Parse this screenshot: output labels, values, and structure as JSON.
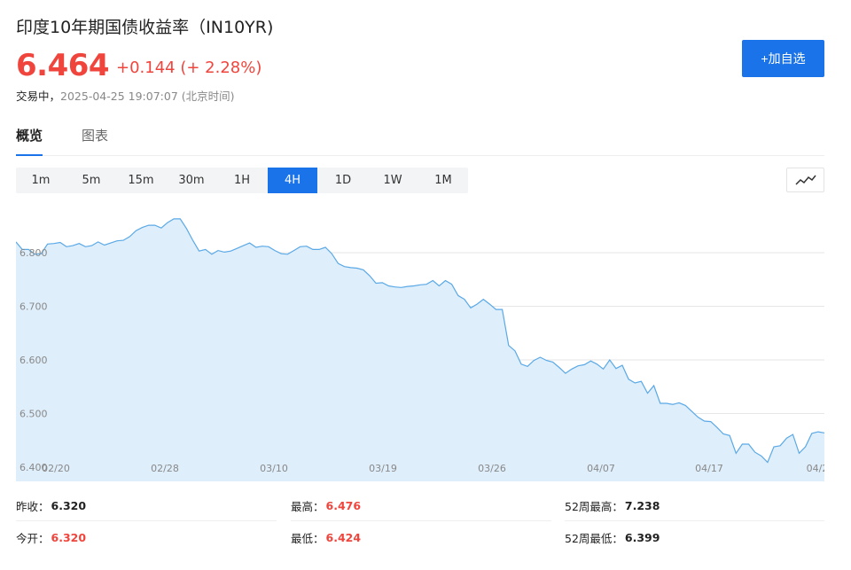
{
  "header": {
    "title": "印度10年期国债收益率（IN10YR)",
    "price": "6.464",
    "change": "+0.144 (+ 2.28%)",
    "status": "交易中，",
    "datetime": "2025-04-25 19:07:07 (北京时间)",
    "add_label": "+加自选"
  },
  "tabs": [
    {
      "label": "概览",
      "active": true
    },
    {
      "label": "图表",
      "active": false
    }
  ],
  "periods": [
    "1m",
    "5m",
    "15m",
    "30m",
    "1H",
    "4H",
    "1D",
    "1W",
    "1M"
  ],
  "active_period": "4H",
  "colors": {
    "accent": "#1a73e8",
    "up": "#f0453d",
    "line": "#5aa9e6",
    "fill": "#dfeefb"
  },
  "chart_data": {
    "type": "area",
    "y_ticks": [
      "6.800",
      "6.700",
      "6.600",
      "6.500",
      "6.400"
    ],
    "x_ticks": [
      "02/20",
      "02/28",
      "03/10",
      "03/19",
      "03/26",
      "04/07",
      "04/17",
      "04/2"
    ],
    "ylim": [
      6.4,
      6.88
    ],
    "values": [
      6.82,
      6.806,
      6.806,
      6.797,
      6.798,
      6.816,
      6.817,
      6.819,
      6.811,
      6.813,
      6.817,
      6.811,
      6.813,
      6.82,
      6.814,
      6.818,
      6.822,
      6.823,
      6.83,
      6.841,
      6.847,
      6.851,
      6.851,
      6.846,
      6.856,
      6.863,
      6.863,
      6.845,
      6.823,
      6.803,
      6.806,
      6.797,
      6.804,
      6.801,
      6.803,
      6.808,
      6.813,
      6.818,
      6.81,
      6.812,
      6.811,
      6.804,
      6.798,
      6.797,
      6.804,
      6.811,
      6.812,
      6.806,
      6.806,
      6.81,
      6.798,
      6.78,
      6.774,
      6.772,
      6.771,
      6.768,
      6.757,
      6.743,
      6.744,
      6.738,
      6.736,
      6.735,
      6.737,
      6.738,
      6.74,
      6.741,
      6.748,
      6.738,
      6.748,
      6.741,
      6.72,
      6.713,
      6.697,
      6.704,
      6.713,
      6.704,
      6.694,
      6.694,
      6.627,
      6.617,
      6.592,
      6.588,
      6.599,
      6.605,
      6.599,
      6.596,
      6.586,
      6.575,
      6.583,
      6.589,
      6.591,
      6.598,
      6.592,
      6.583,
      6.6,
      6.584,
      6.59,
      6.564,
      6.557,
      6.56,
      6.538,
      6.552,
      6.519,
      6.519,
      6.517,
      6.52,
      6.515,
      6.504,
      6.493,
      6.486,
      6.485,
      6.474,
      6.462,
      6.459,
      6.426,
      6.443,
      6.443,
      6.428,
      6.421,
      6.409,
      6.438,
      6.44,
      6.454,
      6.461,
      6.426,
      6.438,
      6.463,
      6.466,
      6.464
    ]
  },
  "stats": [
    [
      {
        "label": "昨收：",
        "value": "6.320",
        "red": false
      },
      {
        "label": "最高：",
        "value": "6.476",
        "red": true
      },
      {
        "label": "52周最高：",
        "value": "7.238",
        "red": false
      }
    ],
    [
      {
        "label": "今开：",
        "value": "6.320",
        "red": true
      },
      {
        "label": "最低：",
        "value": "6.424",
        "red": true
      },
      {
        "label": "52周最低：",
        "value": "6.399",
        "red": false
      }
    ]
  ]
}
